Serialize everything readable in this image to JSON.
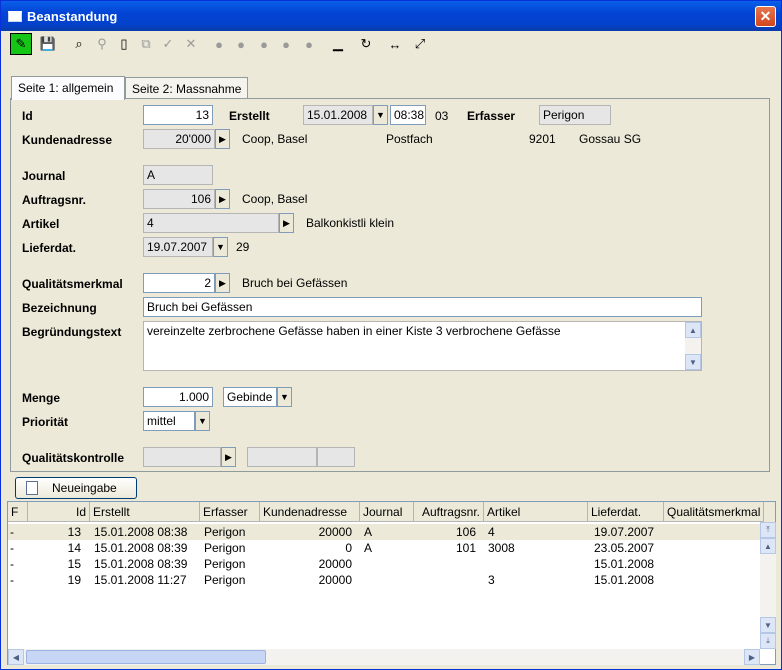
{
  "window": {
    "title": "Beanstandung",
    "close_label": "✕"
  },
  "toolbar": {
    "buttons": [
      {
        "name": "edit-pencil-icon",
        "glyph": "✎"
      },
      {
        "name": "save-icon",
        "glyph": "💾"
      },
      {
        "name": "binoculars-icon",
        "glyph": "⌕"
      },
      {
        "name": "search-key-icon",
        "glyph": "⚲"
      },
      {
        "name": "new-document-icon",
        "glyph": "▯"
      },
      {
        "name": "copy-icon",
        "glyph": "⧉"
      },
      {
        "name": "approve-icon",
        "glyph": "✓"
      },
      {
        "name": "delete-icon",
        "glyph": "✕"
      },
      {
        "name": "first-icon",
        "glyph": "●"
      },
      {
        "name": "prev-icon",
        "glyph": "●"
      },
      {
        "name": "stop-icon",
        "glyph": "●"
      },
      {
        "name": "next-icon",
        "glyph": "●"
      },
      {
        "name": "last-icon",
        "glyph": "●"
      },
      {
        "name": "minimize-icon",
        "glyph": "▁"
      },
      {
        "name": "refresh-icon",
        "glyph": "↻"
      },
      {
        "name": "fit-width-icon",
        "glyph": "↔"
      },
      {
        "name": "fit-page-icon",
        "glyph": "⤢"
      }
    ]
  },
  "tabs": [
    "Seite 1: allgemein",
    "Seite 2: Massnahme"
  ],
  "form": {
    "id_label": "Id",
    "id_value": "13",
    "erstellt_label": "Erstellt",
    "erstellt_date": "15.01.2008",
    "erstellt_time": "08:38",
    "erstellt_extra": "03",
    "erfasser_label": "Erfasser",
    "erfasser_value": "Perigon",
    "kundenadresse_label": "Kundenadresse",
    "kundenadresse_value": "20'000",
    "kunde_name": "Coop, Basel",
    "kunde_postfach": "Postfach",
    "kunde_plz": "9201",
    "kunde_ort": "Gossau SG",
    "journal_label": "Journal",
    "journal_value": "A",
    "auftragsnr_label": "Auftragsnr.",
    "auftragsnr_value": "106",
    "auftrag_name": "Coop, Basel",
    "artikel_label": "Artikel",
    "artikel_value": "4",
    "artikel_name": "Balkonkistli klein",
    "lieferdat_label": "Lieferdat.",
    "lieferdat_value": "19.07.2007",
    "lieferdat_extra": "29",
    "qualitaet_label": "Qualitätsmerkmal",
    "qualitaet_value": "2",
    "qualitaet_name": "Bruch bei Gefässen",
    "bezeichnung_label": "Bezeichnung",
    "bezeichnung_value": "Bruch bei Gefässen",
    "begruendung_label": "Begründungstext",
    "begruendung_value": "vereinzelte zerbrochene Gefässe haben in einer Kiste 3 verbrochene Gefässe",
    "menge_label": "Menge",
    "menge_value": "1.000",
    "menge_unit": "Gebinde",
    "prioritaet_label": "Priorität",
    "prioritaet_value": "mittel",
    "qualitaetskontrolle_label": "Qualitätskontrolle"
  },
  "neueingabe_label": "Neueingabe",
  "grid": {
    "columns": [
      "F",
      "Id",
      "Erstellt",
      "Erfasser",
      "Kundenadresse",
      "Journal",
      "Auftragsnr.",
      "Artikel",
      "Lieferdat.",
      "Qualitätsmerkmal"
    ],
    "rows": [
      {
        "f": "-",
        "id": "13",
        "erstellt": "15.01.2008  08:38",
        "erfasser": "Perigon",
        "kunde": "20000",
        "journal": "A",
        "auftrag": "106",
        "artikel": "4",
        "lieferdat": "19.07.2007"
      },
      {
        "f": "-",
        "id": "14",
        "erstellt": "15.01.2008  08:39",
        "erfasser": "Perigon",
        "kunde": "0",
        "journal": "A",
        "auftrag": "101",
        "artikel": "3008",
        "lieferdat": "23.05.2007"
      },
      {
        "f": "-",
        "id": "15",
        "erstellt": "15.01.2008  08:39",
        "erfasser": "Perigon",
        "kunde": "20000",
        "journal": "",
        "auftrag": "",
        "artikel": "",
        "lieferdat": "15.01.2008"
      },
      {
        "f": "-",
        "id": "19",
        "erstellt": "15.01.2008  11:27",
        "erfasser": "Perigon",
        "kunde": "20000",
        "journal": "",
        "auftrag": "",
        "artikel": "3",
        "lieferdat": "15.01.2008"
      }
    ]
  }
}
